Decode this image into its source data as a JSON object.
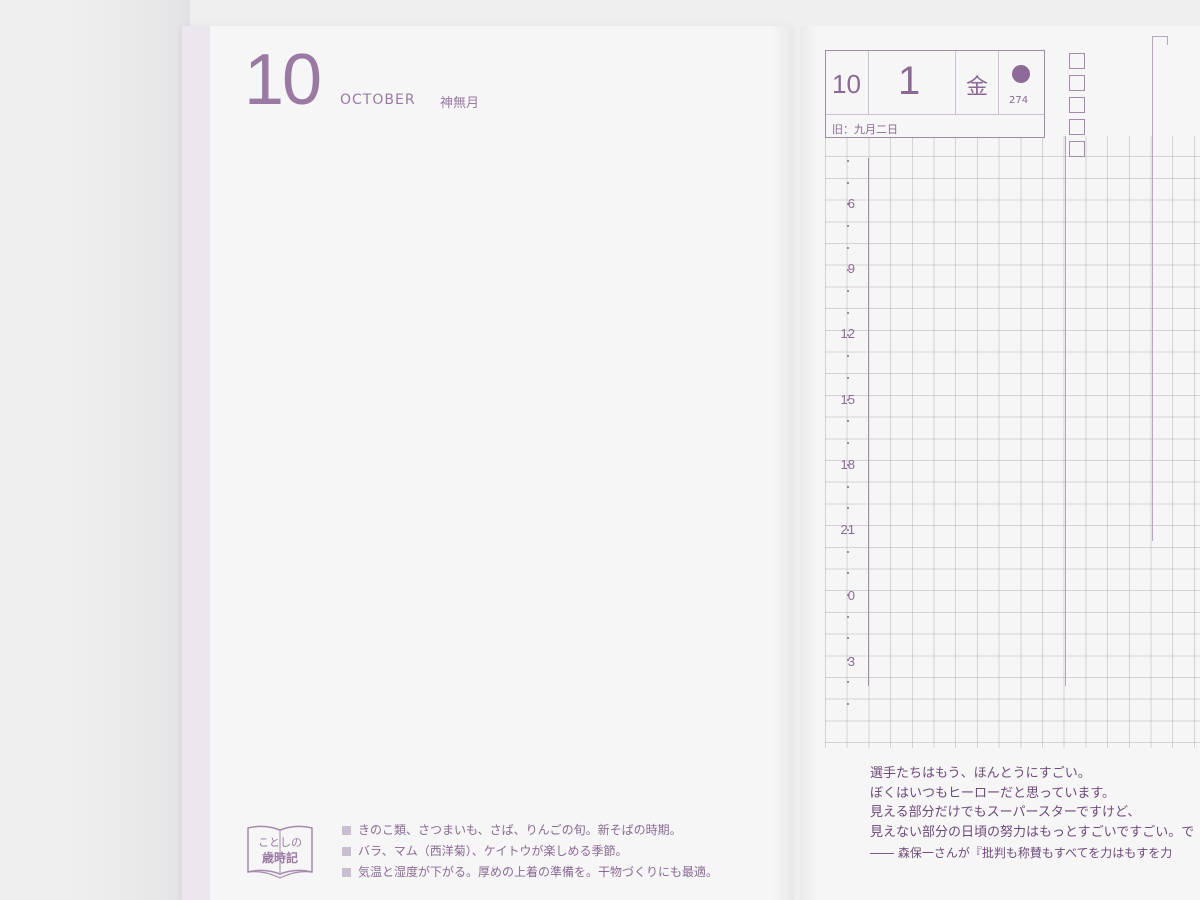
{
  "left_page": {
    "month_number": "10",
    "month_english": "OCTOBER",
    "month_japanese": "神無月",
    "almanac": {
      "label_line1": "ことしの",
      "label_line2": "歳時記",
      "items": [
        "きのこ類、さつまいも、さば、りんごの旬。新そばの時期。",
        "バラ、マム（西洋菊）、ケイトウが楽しめる季節。",
        "気温と湿度が下がる。厚めの上着の準備を。干物づくりにも最適。"
      ]
    }
  },
  "right_page": {
    "date": {
      "month": "10",
      "day": "1",
      "weekday": "金",
      "day_of_year": "274",
      "old_calendar": "旧：九月二日"
    },
    "hour_labels": [
      "6",
      "9",
      "12",
      "15",
      "18",
      "21",
      "0",
      "3"
    ],
    "quote": {
      "lines": [
        "選手たちはもう、ほんとうにすごい。",
        "ぼくはいつもヒーローだと思っています。",
        "見える部分だけでもスーパースターですけど、",
        "見えない部分の日頃の努力はもっとすごいですごい。で"
      ],
      "source": "―― 森保一さんが『批判も称賛もすべてを力はもすを力"
    }
  },
  "colors": {
    "accent": "#8a6a94",
    "page": "#f6f6f6",
    "background": "#efefef"
  }
}
